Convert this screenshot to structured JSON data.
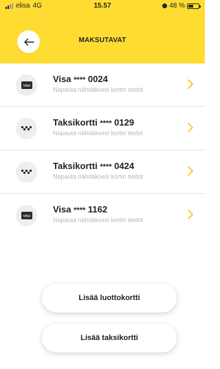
{
  "status_bar": {
    "carrier": "elisa",
    "network": "4G",
    "time": "15.57",
    "battery_percent": "48 %",
    "battery_level": 0.48
  },
  "header": {
    "title": "MAKSUTAVAT",
    "back_icon": "arrow-left-icon",
    "background_color": "#fedc32"
  },
  "cards": [
    {
      "type_icon": "visa-card-icon",
      "brand": "Visa",
      "masked": "****",
      "last4": "0024",
      "hint": "Napauta nähdäksesi kortin tiedot"
    },
    {
      "type_icon": "taxi-card-icon",
      "brand": "Taksikortti",
      "masked": "****",
      "last4": "0129",
      "hint": "Napauta nähdäksesi kortin tiedot"
    },
    {
      "type_icon": "taxi-card-icon",
      "brand": "Taksikortti",
      "masked": "****",
      "last4": "0424",
      "hint": "Napauta nähdäksesi kortin tiedot"
    },
    {
      "type_icon": "visa-card-icon",
      "brand": "Visa",
      "masked": "****",
      "last4": "1162",
      "hint": "Napauta nähdäksesi kortin tiedot"
    }
  ],
  "actions": {
    "add_credit_card": "Lisää luottokortti",
    "add_taxi_card": "Lisää taksikortti"
  },
  "colors": {
    "accent": "#fedc32",
    "chevron": "#f5c518"
  }
}
